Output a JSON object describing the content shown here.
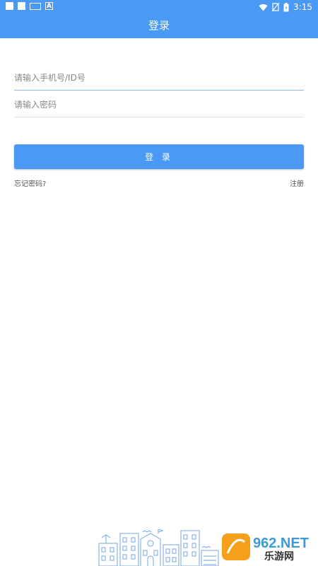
{
  "status_bar": {
    "time": "3:15",
    "left_icons": [
      "notification-square-icon",
      "notification-square-icon",
      "keyboard-icon",
      "a-app-icon"
    ],
    "right_icons": [
      "wifi-icon",
      "no-sim-icon",
      "battery-icon"
    ]
  },
  "header": {
    "title": "登录"
  },
  "form": {
    "phone_placeholder": "请输入手机号/ID号",
    "password_placeholder": "请输入密码",
    "login_label": "登 录",
    "forgot_label": "忘记密码?",
    "register_label": "注册"
  },
  "watermark": {
    "logo_text": "962.NET",
    "sub_text": "乐游网"
  },
  "colors": {
    "primary": "#4a9af5",
    "divider": "#e2e2e2",
    "active_divider": "#8fb8e8"
  }
}
